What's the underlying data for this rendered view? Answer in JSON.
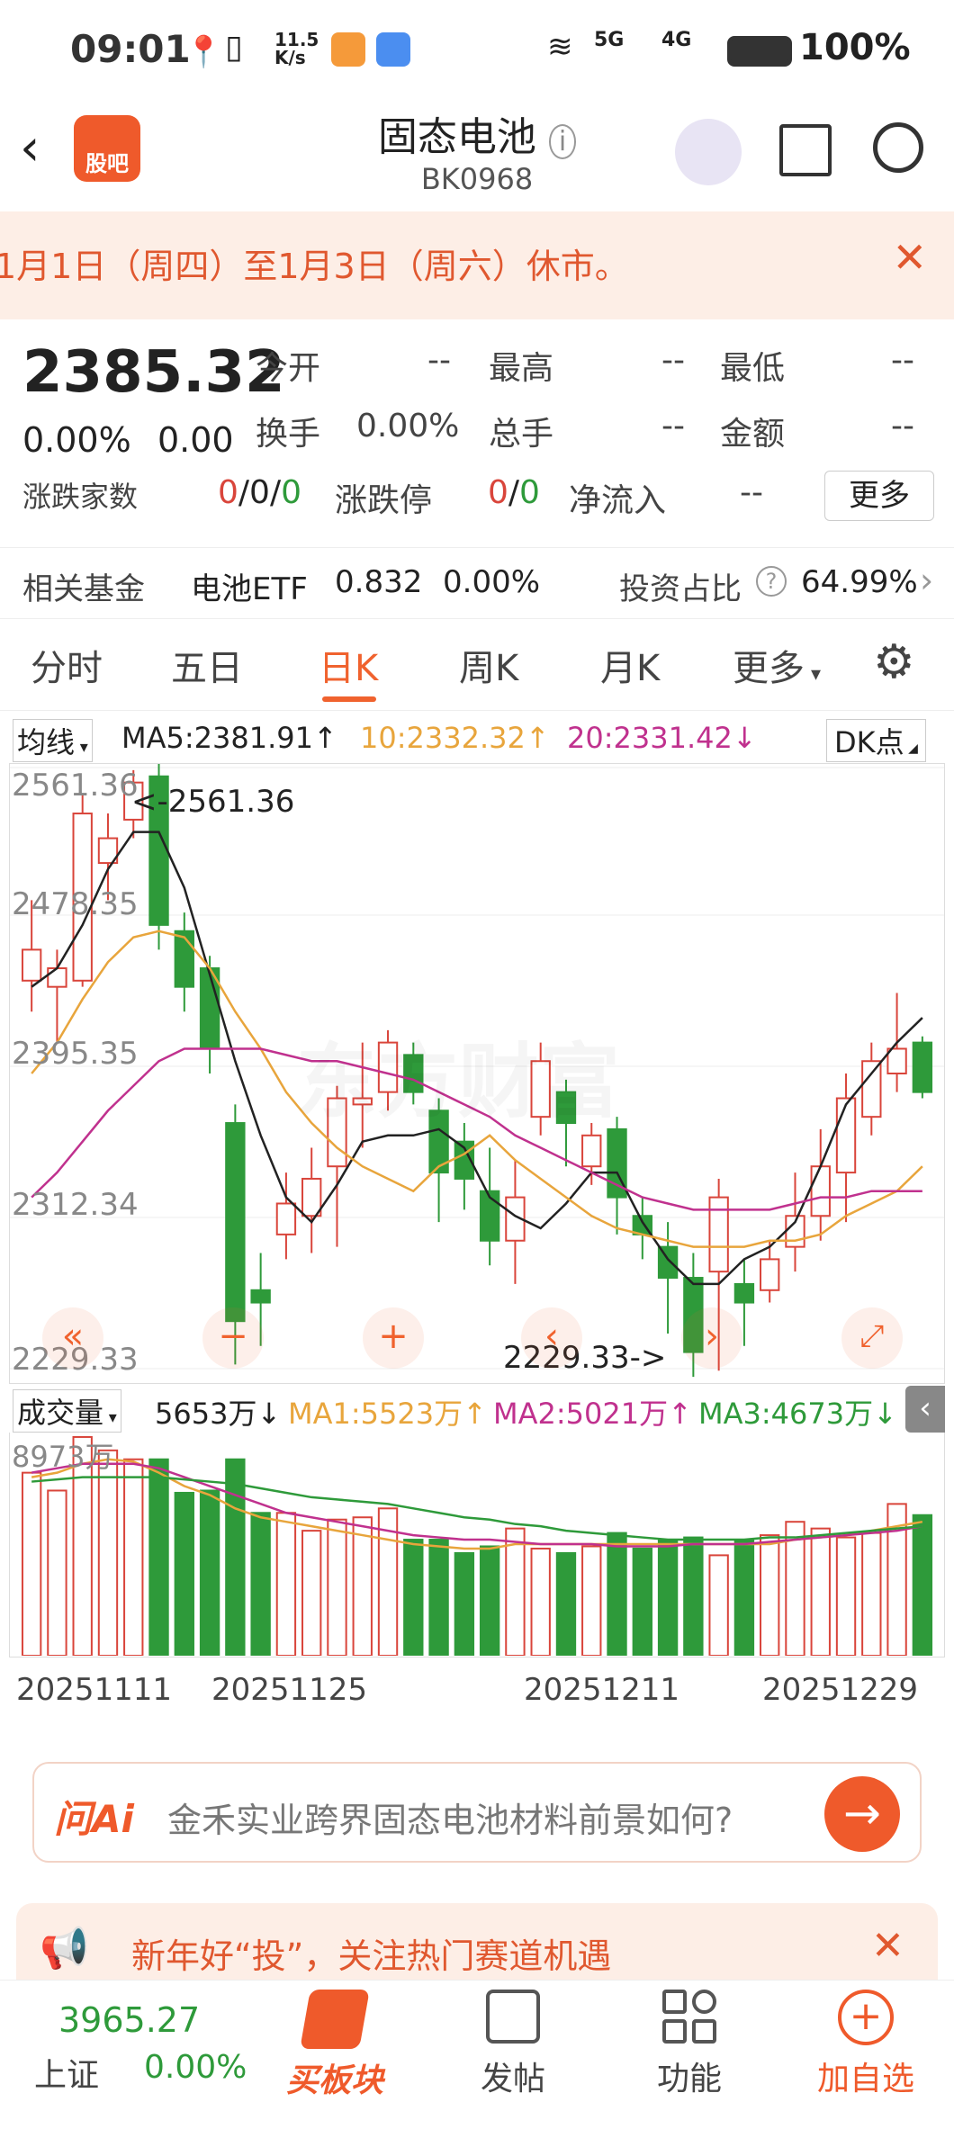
{
  "status_bar": {
    "time": "09:01",
    "speed": "11.5\nK/s",
    "battery": "100%",
    "net1": "5G",
    "net2": "4G"
  },
  "nav": {
    "title": "固态电池",
    "code": "BK0968",
    "logo_text": "股吧"
  },
  "notice": {
    "text": "1月1日（周四）至1月3日（周六）休市。"
  },
  "quote": {
    "price": "2385.32",
    "change_pct": "0.00%",
    "change": "0.00",
    "open_label": "今开",
    "open": "--",
    "high_label": "最高",
    "high": "--",
    "low_label": "最低",
    "low": "--",
    "turnover_label": "换手",
    "turnover": "0.00%",
    "total_label": "总手",
    "total": "--",
    "amount_label": "金额",
    "amount": "--",
    "count_label": "涨跌家数",
    "count_up": "0",
    "count_flat": "0",
    "count_down": "0",
    "limit_label": "涨跌停",
    "limit_up": "0",
    "limit_down": "0",
    "inflow_label": "净流入",
    "inflow": "--",
    "more": "更多",
    "sep": "/"
  },
  "fund": {
    "label": "相关基金",
    "name": "电池ETF",
    "price": "0.832",
    "pct": "0.00%",
    "ratio_label": "投资占比",
    "ratio": "64.99%"
  },
  "tabs": [
    "分时",
    "五日",
    "日K",
    "周K",
    "月K",
    "更多"
  ],
  "chart": {
    "ma_selector": "均线",
    "ma5": "MA5:2381.91↑",
    "ma10": "10:2332.32↑",
    "ma20": "20:2331.42↓",
    "dk": "DK点",
    "y_labels": [
      "2561.36",
      "2478.35",
      "2395.35",
      "2312.34",
      "2229.33"
    ],
    "high_marker": "<-2561.36",
    "low_marker": "2229.33->",
    "watermark": "东方财富"
  },
  "volume": {
    "selector": "成交量",
    "value": "5653万↓",
    "ma1": "MA1:5523万↑",
    "ma2": "MA2:5021万↑",
    "ma3": "MA3:4673万↓",
    "ymax": "8973万"
  },
  "dates": [
    "20251111",
    "20251125",
    "20251211",
    "20251229"
  ],
  "ai": {
    "brand": "问Ai",
    "query": "金禾实业跨界固态电池材料前景如何?"
  },
  "promo": {
    "text": "新年好“投”，关注热门赛道机遇"
  },
  "bottom": {
    "index_value": "3965.27",
    "index_name": "上证",
    "index_pct": "0.00%",
    "items": [
      "买板块",
      "发帖",
      "功能",
      "加自选"
    ]
  },
  "colors": {
    "up": "#d9453b",
    "down": "#2e9a3a",
    "accent": "#f0622e",
    "ma5": "#222222",
    "ma10": "#e8a53c",
    "ma20": "#c0318e"
  }
}
